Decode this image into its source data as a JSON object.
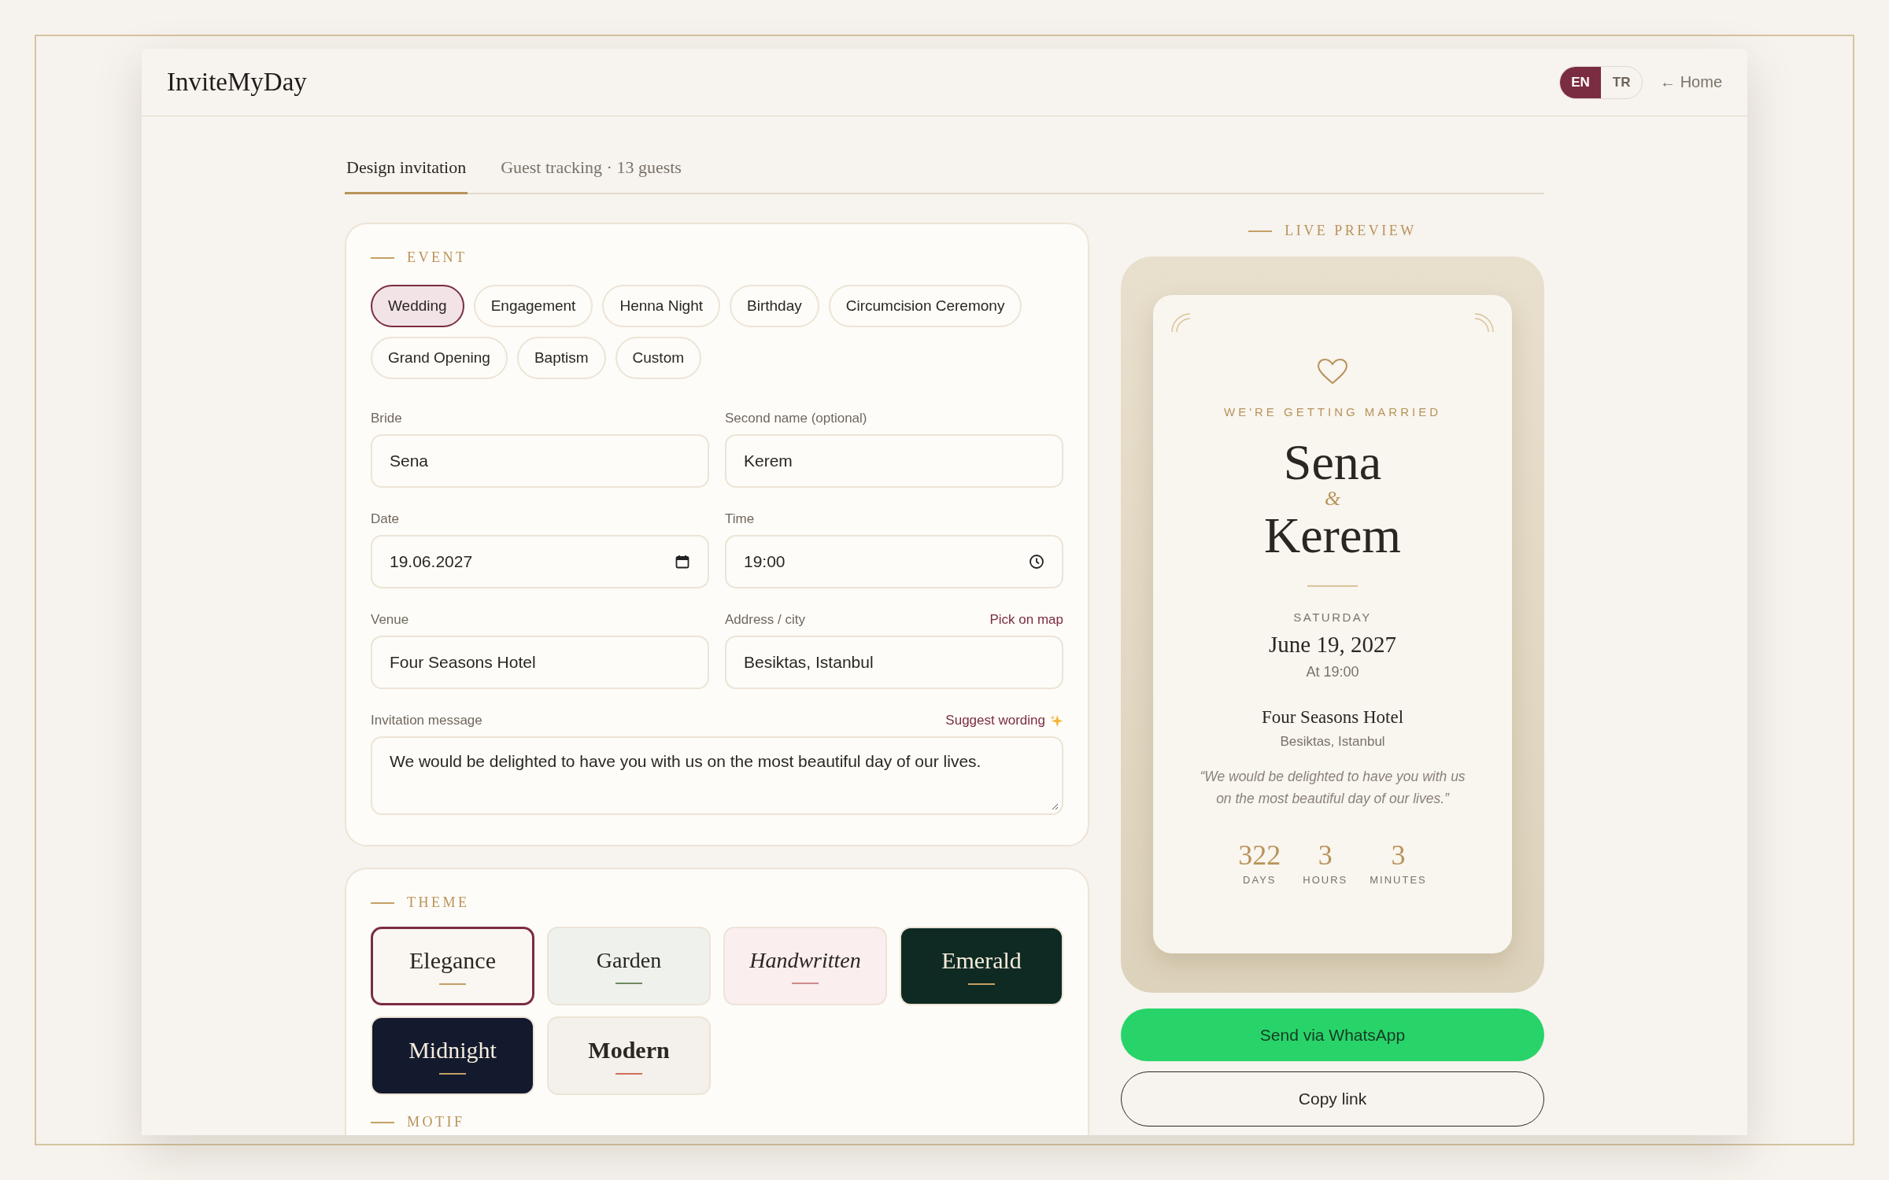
{
  "header": {
    "logo": "InviteMyDay",
    "languages": [
      {
        "label": "EN",
        "selected": true
      },
      {
        "label": "TR",
        "selected": false
      }
    ],
    "home_link": "← Home"
  },
  "tabs": [
    {
      "label": "Design invitation",
      "selected": true
    },
    {
      "label": "Guest tracking · 13 guests",
      "selected": false
    }
  ],
  "event": {
    "title": "EVENT",
    "types": [
      {
        "label": "Wedding",
        "selected": true
      },
      {
        "label": "Engagement",
        "selected": false
      },
      {
        "label": "Henna Night",
        "selected": false
      },
      {
        "label": "Birthday",
        "selected": false
      },
      {
        "label": "Circumcision Ceremony",
        "selected": false
      },
      {
        "label": "Grand Opening",
        "selected": false
      },
      {
        "label": "Baptism",
        "selected": false
      },
      {
        "label": "Custom",
        "selected": false
      }
    ],
    "fields": [
      {
        "label": "Bride",
        "value": "Sena",
        "kind": "text"
      },
      {
        "label": "Second name (optional)",
        "value": "Kerem",
        "kind": "text"
      },
      {
        "label": "Date",
        "value": "19.06.2027",
        "kind": "date"
      },
      {
        "label": "Time",
        "value": "19:00",
        "kind": "time"
      },
      {
        "label": "Venue",
        "value": "Four Seasons Hotel",
        "kind": "text"
      },
      {
        "label": "Address / city",
        "value": "Besiktas, Istanbul",
        "kind": "text",
        "action": "Pick on map"
      },
      {
        "label": "Invitation message",
        "value": "We would be delighted to have you with us on the most beautiful day of our lives.",
        "kind": "textarea",
        "action": "Suggest wording"
      }
    ]
  },
  "theme": {
    "title": "THEME",
    "options": [
      {
        "label": "Elegance",
        "kind": "classic",
        "color": "#faf6f1",
        "selected": true
      },
      {
        "label": "Garden",
        "kind": "light",
        "color": "#eff2ec",
        "selected": false
      },
      {
        "label": "Handwritten",
        "kind": "script",
        "color": "#faeeee",
        "selected": false
      },
      {
        "label": "Emerald",
        "kind": "classic",
        "color": "#0f2a22",
        "selected": false
      },
      {
        "label": "Midnight",
        "kind": "classic",
        "color": "#141a2e",
        "selected": false
      },
      {
        "label": "Modern",
        "kind": "bold",
        "color": "#f4f0ec",
        "selected": false
      }
    ]
  },
  "motif": {
    "title": "MOTIF"
  },
  "preview": {
    "title": "LIVE PREVIEW",
    "headline": "WE'RE GETTING MARRIED",
    "name_1": "Sena",
    "connector": "&",
    "name_2": "Kerem",
    "weekday": "SATURDAY",
    "date": "June 19, 2027",
    "time": "At 19:00",
    "venue": "Four Seasons Hotel",
    "city": "Besiktas, Istanbul",
    "message": "“We would be delighted to have you with us on the most beautiful day of our lives.”",
    "countdown": [
      {
        "value": "322",
        "unit": "DAYS"
      },
      {
        "value": "3",
        "unit": "HOURS"
      },
      {
        "value": "3",
        "unit": "MINUTES"
      }
    ]
  },
  "actions": {
    "whatsapp": "Send via WhatsApp",
    "copy": "Copy link"
  }
}
